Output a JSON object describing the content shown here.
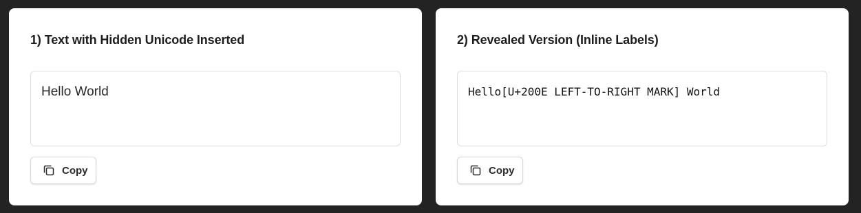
{
  "panels": [
    {
      "title": "1) Text with Hidden Unicode Inserted",
      "text": "Hello‎ World",
      "copy_label": "Copy",
      "copy_icon": "copy-icon"
    },
    {
      "title": "2) Revealed Version (Inline Labels)",
      "text": "Hello[U+200E LEFT-TO-RIGHT MARK] World",
      "copy_label": "Copy",
      "copy_icon": "copy-icon"
    }
  ]
}
